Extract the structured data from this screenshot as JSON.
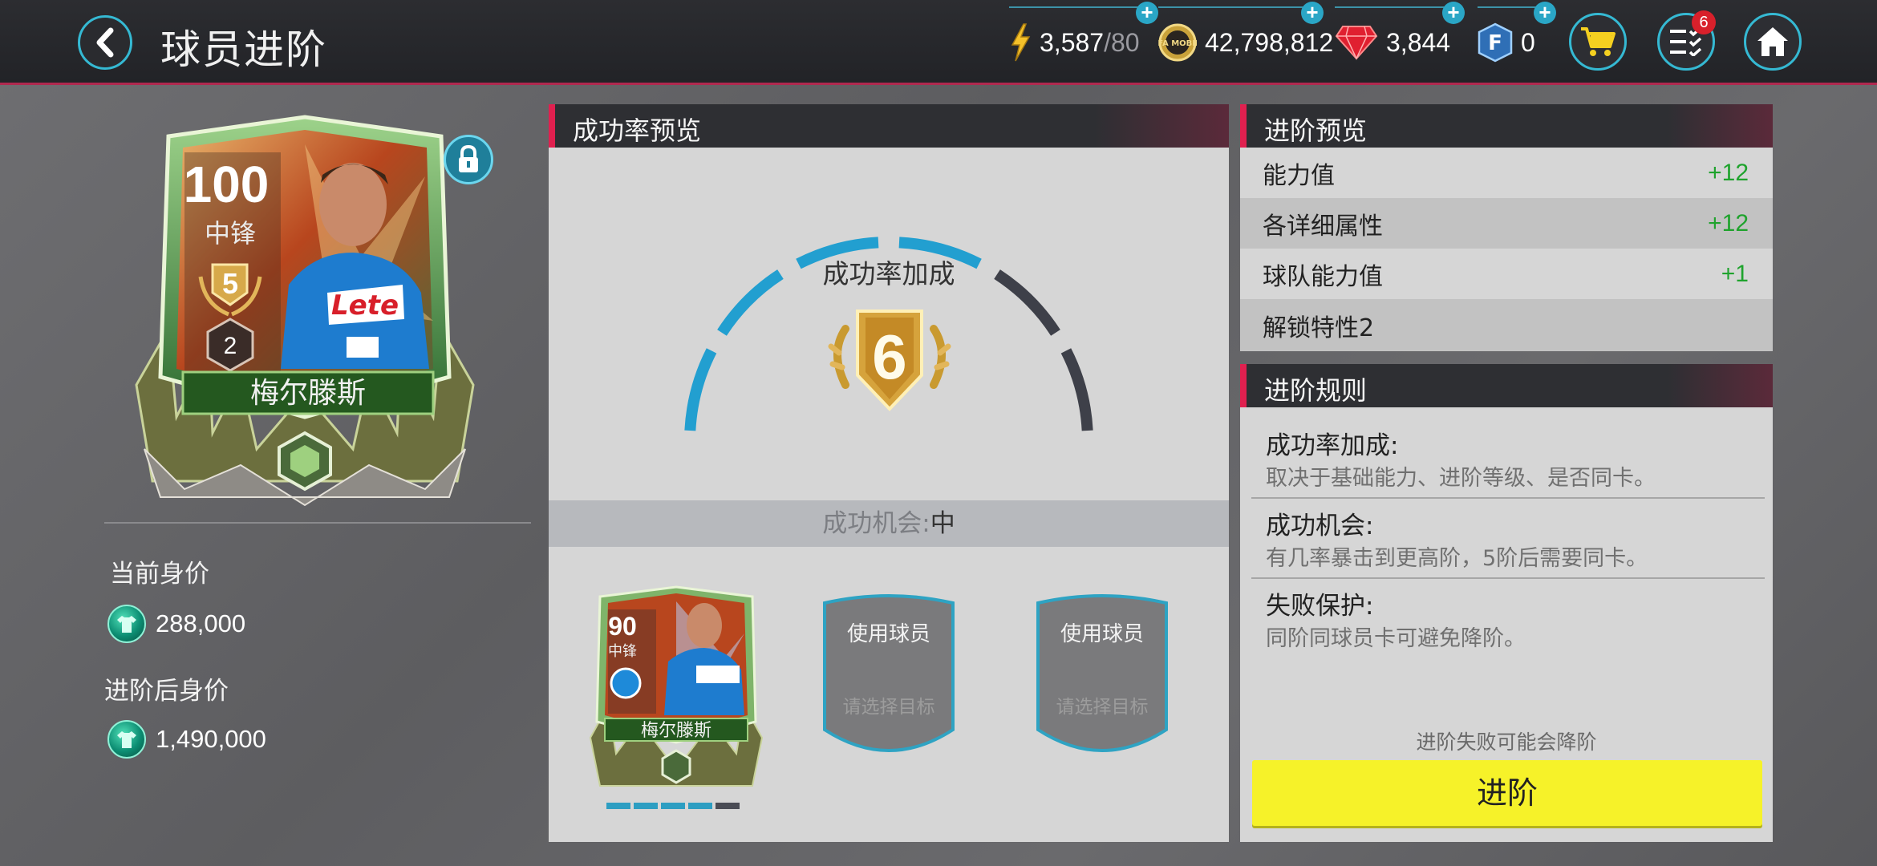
{
  "header": {
    "title": "球员进阶",
    "stamina": {
      "value": "3,587",
      "max": "/80"
    },
    "coins": "42,798,812",
    "gems": "3,844",
    "fifa_points": "0",
    "menu_badge": "6",
    "coin_logo_text": "FIFA MOBILE",
    "fp_logo_text": "F"
  },
  "player_card": {
    "rating": "100",
    "position": "中锋",
    "rank_level": "5",
    "sub_level": "2",
    "name": "梅尔滕斯",
    "jersey_text": "Lete"
  },
  "values": {
    "current_label": "当前身价",
    "current_value": "288,000",
    "after_label": "进阶后身价",
    "after_value": "1,490,000"
  },
  "success_panel": {
    "title": "成功率预览",
    "gauge_label": "成功率加成",
    "bonus": "6",
    "gauge": {
      "filled_segments": 4,
      "total_segments": 6
    },
    "chance_label": "成功机会:",
    "chance_value": "中",
    "material_card": {
      "rating": "90",
      "position": "中锋",
      "name": "梅尔滕斯"
    },
    "slots": [
      {
        "label": "使用球员",
        "hint": "请选择目标"
      },
      {
        "label": "使用球员",
        "hint": "请选择目标"
      }
    ],
    "pips": {
      "filled": 4,
      "total": 5
    }
  },
  "upgrade_preview": {
    "title": "进阶预览",
    "rows": [
      {
        "label": "能力值",
        "value": "+12"
      },
      {
        "label": "各详细属性",
        "value": "+12"
      },
      {
        "label": "球队能力值",
        "value": "+1"
      },
      {
        "label": "解锁特性2",
        "value": ""
      }
    ]
  },
  "rules": {
    "title": "进阶规则",
    "items": [
      {
        "heading": "成功率加成:",
        "desc": "取决于基础能力、进阶等级、是否同卡。"
      },
      {
        "heading": "成功机会:",
        "desc": "有几率暴击到更高阶，5阶后需要同卡。"
      },
      {
        "heading": "失败保护:",
        "desc": "同阶同球员卡可避免降阶。"
      }
    ],
    "warning": "进阶失败可能会降阶",
    "button": "进阶"
  },
  "colors": {
    "accent": "#2aa6c6",
    "header_stripe": "#e0204f",
    "positive": "#1fa32d",
    "button": "#f6f229"
  }
}
